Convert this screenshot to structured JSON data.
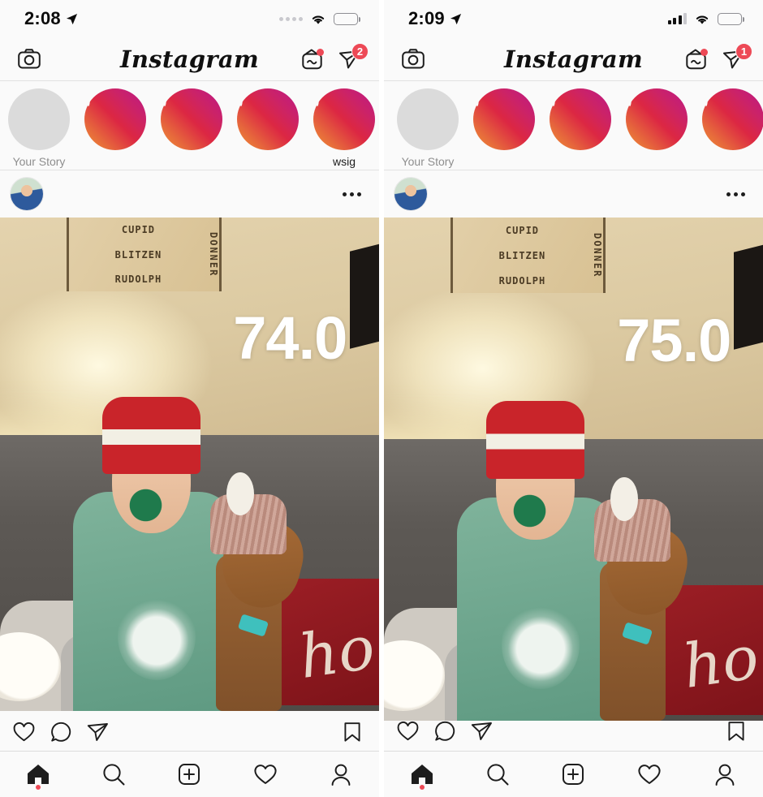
{
  "panels": [
    {
      "id": "left",
      "status": {
        "time": "2:08",
        "location_icon": "location-arrow-icon",
        "signal_style": "dots",
        "signal_bars": 0,
        "wifi_icon": "wifi-icon",
        "battery_icon": "battery-full-icon"
      },
      "nav": {
        "camera_label": "camera-icon",
        "title": "Instagram",
        "igtv_label": "igtv-icon",
        "igtv_has_dot": true,
        "direct_label": "direct-message-icon",
        "direct_badge": "2"
      },
      "stories": [
        {
          "label": "Your Story",
          "own": true,
          "label_dark": false
        },
        {
          "label": "",
          "own": false,
          "label_dark": false
        },
        {
          "label": "",
          "own": false,
          "label_dark": false
        },
        {
          "label": "",
          "own": false,
          "label_dark": false
        },
        {
          "label": "wsig",
          "own": false,
          "label_dark": true
        }
      ],
      "post": {
        "username": "",
        "more_label": "more-options-icon",
        "overlay_value": "74.0",
        "sign_text_left": [
          "CUPID",
          "BLITZEN",
          "RUDOLPH"
        ],
        "sign_text_vertical": "DONNER",
        "pillow_text": "ho"
      },
      "actions": {
        "like": "heart-icon",
        "comment": "comment-icon",
        "share": "share-icon",
        "save": "bookmark-icon"
      },
      "tabs": [
        {
          "name": "home",
          "icon": "home-icon",
          "active": true
        },
        {
          "name": "search",
          "icon": "search-icon",
          "active": false
        },
        {
          "name": "add",
          "icon": "plus-box-icon",
          "active": false
        },
        {
          "name": "activity",
          "icon": "heart-icon",
          "active": false
        },
        {
          "name": "profile",
          "icon": "person-icon",
          "active": false
        }
      ]
    },
    {
      "id": "right",
      "status": {
        "time": "2:09",
        "location_icon": "location-arrow-icon",
        "signal_style": "bars",
        "signal_bars": 3,
        "wifi_icon": "wifi-icon",
        "battery_icon": "battery-full-icon"
      },
      "nav": {
        "camera_label": "camera-icon",
        "title": "Instagram",
        "igtv_label": "igtv-icon",
        "igtv_has_dot": true,
        "direct_label": "direct-message-icon",
        "direct_badge": "1"
      },
      "stories": [
        {
          "label": "Your Story",
          "own": true,
          "label_dark": false
        },
        {
          "label": "",
          "own": false,
          "label_dark": false
        },
        {
          "label": "",
          "own": false,
          "label_dark": false
        },
        {
          "label": "",
          "own": false,
          "label_dark": false
        },
        {
          "label": "",
          "own": false,
          "label_dark": false
        }
      ],
      "post": {
        "username": "",
        "more_label": "more-options-icon",
        "overlay_value": "75.0",
        "sign_text_left": [
          "CUPID",
          "BLITZEN",
          "RUDOLPH"
        ],
        "sign_text_vertical": "DONNER",
        "pillow_text": "ho"
      },
      "actions": {
        "like": "heart-icon",
        "comment": "comment-icon",
        "share": "share-icon",
        "save": "bookmark-icon"
      },
      "tabs": [
        {
          "name": "home",
          "icon": "home-icon",
          "active": true
        },
        {
          "name": "search",
          "icon": "search-icon",
          "active": false
        },
        {
          "name": "add",
          "icon": "plus-box-icon",
          "active": false
        },
        {
          "name": "activity",
          "icon": "heart-icon",
          "active": false
        },
        {
          "name": "profile",
          "icon": "person-icon",
          "active": false
        }
      ]
    }
  ],
  "colors": {
    "badge_red": "#ed4956",
    "bg": "#fafafa",
    "text": "#262626",
    "muted": "#8e8e8e",
    "story_ring_start": "#f09433",
    "story_ring_end": "#bc1888"
  }
}
